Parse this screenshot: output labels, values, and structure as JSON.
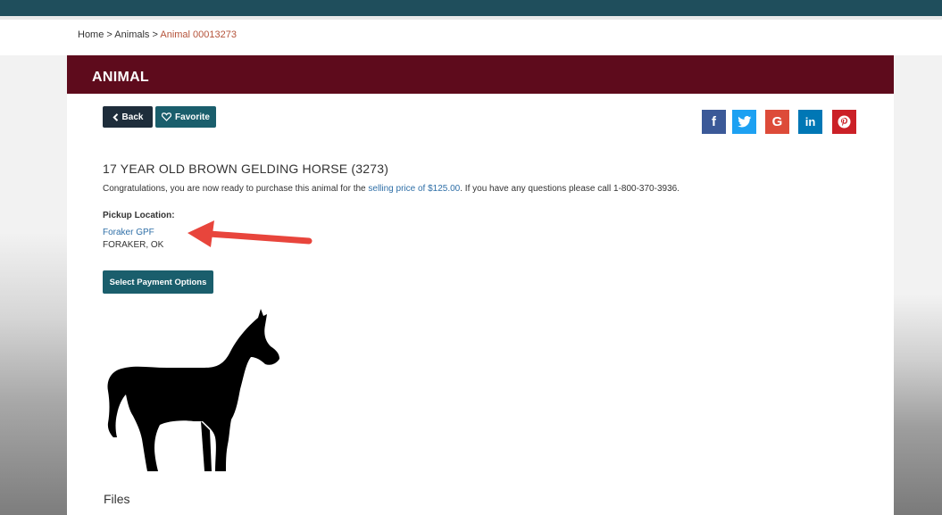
{
  "breadcrumb": {
    "home": "Home",
    "sep1": ">",
    "animals": "Animals",
    "sep2": ">",
    "current": "Animal 00013273"
  },
  "panel": {
    "header": "ANIMAL"
  },
  "actions": {
    "back_label": "Back",
    "favorite_label": "Favorite"
  },
  "social": {
    "facebook": "f",
    "twitter": "t",
    "google": "G",
    "linkedin": "in",
    "pinterest": "p"
  },
  "animal": {
    "title": "17 YEAR OLD BROWN GELDING HORSE (3273)",
    "congrats_prefix": "Congratulations, you are now ready to purchase this animal for the ",
    "price_link": "selling price of $125.00",
    "congrats_suffix": ". If you have any questions please call 1-800-370-3936."
  },
  "pickup": {
    "label": "Pickup Location:",
    "name": "Foraker GPF",
    "city": "FORAKER, OK"
  },
  "payment": {
    "button_label": "Select Payment Options"
  },
  "files": {
    "heading": "Files"
  },
  "colors": {
    "header": "#5e0b1c",
    "topbar": "#1f4e5c",
    "button_dark": "#1e2d3b",
    "button_teal": "#1a5e6c",
    "link": "#2f6fa7",
    "arrow": "#e8453c"
  }
}
